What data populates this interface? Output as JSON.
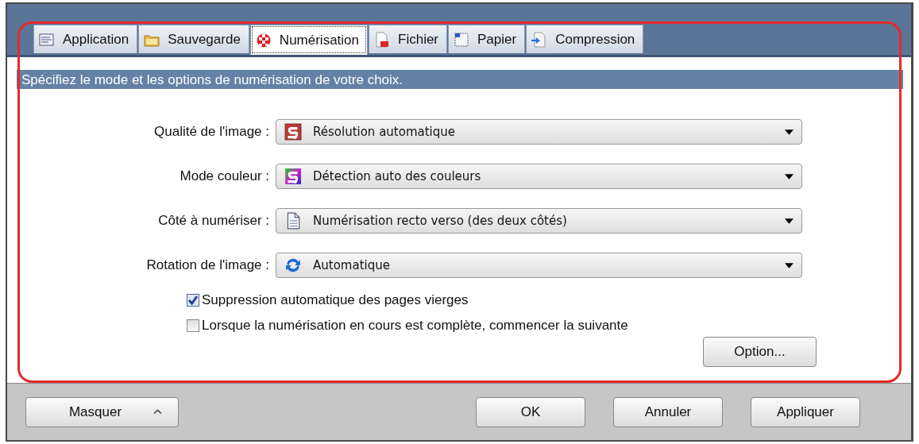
{
  "tabs": [
    {
      "label": "Application",
      "kind": "app",
      "selected": false
    },
    {
      "label": "Sauvegarde",
      "kind": "folder",
      "selected": false
    },
    {
      "label": "Numérisation",
      "kind": "scan",
      "selected": true
    },
    {
      "label": "Fichier",
      "kind": "file",
      "selected": false
    },
    {
      "label": "Papier",
      "kind": "paper",
      "selected": false
    },
    {
      "label": "Compression",
      "kind": "compress",
      "selected": false
    }
  ],
  "header": "Spécifiez le mode et les options de numérisation de votre choix.",
  "settings": [
    {
      "label": "Qualité de l'image :",
      "value": "Résolution automatique",
      "kind": "quality"
    },
    {
      "label": "Mode couleur :",
      "value": "Détection auto des couleurs",
      "kind": "color"
    },
    {
      "label": "Côté à numériser :",
      "value": "Numérisation recto verso (des deux côtés)",
      "kind": "page"
    },
    {
      "label": "Rotation de l'image :",
      "value": "Automatique",
      "kind": "rotate"
    }
  ],
  "options": [
    {
      "label": "Suppression automatique des pages vierges",
      "checked": true
    },
    {
      "label": "Lorsque la numérisation en cours est complète, commencer la suivante",
      "checked": false
    }
  ],
  "option_button": "Option...",
  "footer": {
    "toggle": "Masquer",
    "buttons": [
      "OK",
      "Annuler",
      "Appliquer"
    ]
  }
}
